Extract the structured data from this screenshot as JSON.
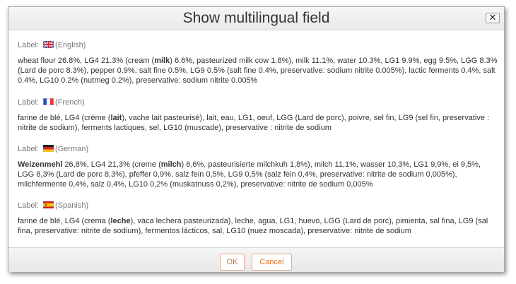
{
  "dialog": {
    "title": "Show multilingual field",
    "close_icon": "close-icon",
    "close_glyph": "✕"
  },
  "label_prefix": "Label:",
  "sections": [
    {
      "language": "(English)",
      "flag": "flag-uk-icon",
      "parts": [
        {
          "t": "wheat flour 26.8%, LG4 21.3% (cream ("
        },
        {
          "t": "milk",
          "bold": true
        },
        {
          "t": ") 6.6%, pasteurized milk cow 1.8%), milk 11.1%, water 10.3%, LG1 9.9%, egg 9.5%, LGG 8.3% (Lard de porc 8.3%), pepper 0.9%, salt fine 0.5%, LG9 0.5% (salt fine 0.4%, preservative: sodium nitrite 0.005%), lactic ferments 0.4%, salt 0.4%, LG10 0.2% (nutmeg 0.2%), preservative: sodium nitrite 0.005%"
        }
      ]
    },
    {
      "language": "(French)",
      "flag": "flag-france-icon",
      "parts": [
        {
          "t": "farine de blé, LG4 (crème ("
        },
        {
          "t": "lait",
          "bold": true
        },
        {
          "t": "), vache lait pasteurisé), lait, eau, LG1, oeuf, LGG (Lard de porc), poivre, sel fin, LG9 (sel fin, preservative : nitrite de sodium), ferments lactiques, sel, LG10 (muscade), preservative : nitrite de sodium"
        }
      ]
    },
    {
      "language": "(German)",
      "flag": "flag-germany-icon",
      "parts": [
        {
          "t": "Weizenmehl",
          "bold": true
        },
        {
          "t": " 26,8%, LG4 21,3% (creme ("
        },
        {
          "t": "milch",
          "bold": true
        },
        {
          "t": ") 6,6%, pasteurisierte milchkuh 1,8%), milch 11,1%, wasser 10,3%, LG1 9,9%, ei 9,5%, LGG 8,3% (Lard de porc 8,3%), pfeffer 0,9%, salz fein 0,5%, LG9 0,5% (salz fein 0,4%, preservative: nitrite de sodium 0,005%), milchfermente 0,4%, salz 0,4%, LG10 0,2% (muskatnuss 0,2%), preservative: nitrite de sodium 0,005%"
        }
      ]
    },
    {
      "language": "(Spanish)",
      "flag": "flag-spain-icon",
      "parts": [
        {
          "t": "farine de blé, LG4 (crema ("
        },
        {
          "t": "leche",
          "bold": true
        },
        {
          "t": "), vaca lechera pasteurizada), leche, agua, LG1, huevo, LGG (Lard de porc), pimienta, sal fina, LG9 (sal fina, preservative: nitrite de sodium), fermentos lácticos, sal, LG10 (nuez moscada), preservative: nitrite de sodium"
        }
      ]
    }
  ],
  "footer": {
    "ok_label": "OK",
    "cancel_label": "Cancel",
    "accent_color": "#e0702f"
  }
}
